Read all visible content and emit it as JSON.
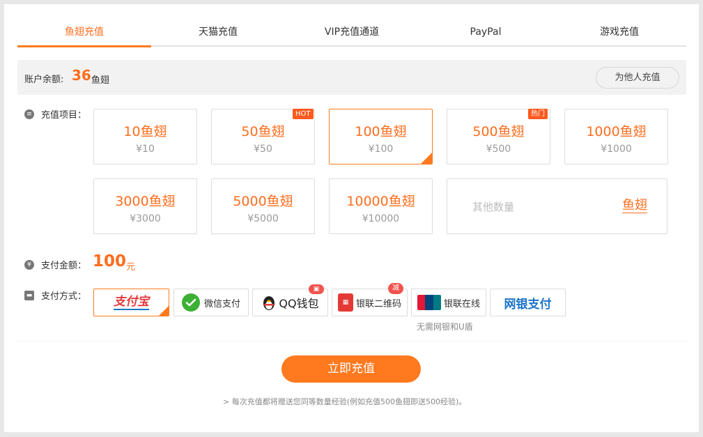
{
  "tabs": [
    {
      "label": "鱼翅充值",
      "active": true
    },
    {
      "label": "天猫充值",
      "active": false
    },
    {
      "label": "VIP充值通道",
      "active": false
    },
    {
      "label": "PayPal",
      "active": false
    },
    {
      "label": "游戏充值",
      "active": false
    }
  ],
  "balance": {
    "label": "账户余额:",
    "value": "36",
    "unit": "鱼翅",
    "others_button": "为他人充值"
  },
  "recharge": {
    "label": "充值项目：",
    "items": [
      {
        "amount": "10鱼翅",
        "price": "¥10"
      },
      {
        "amount": "50鱼翅",
        "price": "¥50",
        "badge": "HOT"
      },
      {
        "amount": "100鱼翅",
        "price": "¥100",
        "selected": true
      },
      {
        "amount": "500鱼翅",
        "price": "¥500",
        "badge": "热门"
      },
      {
        "amount": "1000鱼翅",
        "price": "¥1000"
      },
      {
        "amount": "3000鱼翅",
        "price": "¥3000"
      },
      {
        "amount": "5000鱼翅",
        "price": "¥5000"
      },
      {
        "amount": "10000鱼翅",
        "price": "¥10000"
      }
    ],
    "other": {
      "placeholder": "其他数量",
      "unit": "鱼翅"
    }
  },
  "pay_amount": {
    "label": "支付金额：",
    "value": "100",
    "unit": "元"
  },
  "pay_method": {
    "label": "支付方式：",
    "methods": [
      {
        "label": "支付宝",
        "icon": "alipay-logo",
        "selected": true
      },
      {
        "label": "微信支付",
        "icon": "wechat-icon"
      },
      {
        "label": "QQ钱包",
        "icon": "qq-penguin-icon",
        "badge": "gift"
      },
      {
        "label": "银联二维码",
        "icon": "unionpay-qr-icon",
        "badge": "减"
      },
      {
        "label": "银联在线",
        "icon": "unionpay-icon"
      },
      {
        "label": "网银支付",
        "icon": ""
      }
    ],
    "note": "无需网银和U盾"
  },
  "submit": "立即充值",
  "tip": "> 每次充值都将赠送您同等数量经验(例如充值500鱼翅即送500经验)。",
  "colors": {
    "accent": "#ff7a1f",
    "badge": "#ff5a1f"
  }
}
